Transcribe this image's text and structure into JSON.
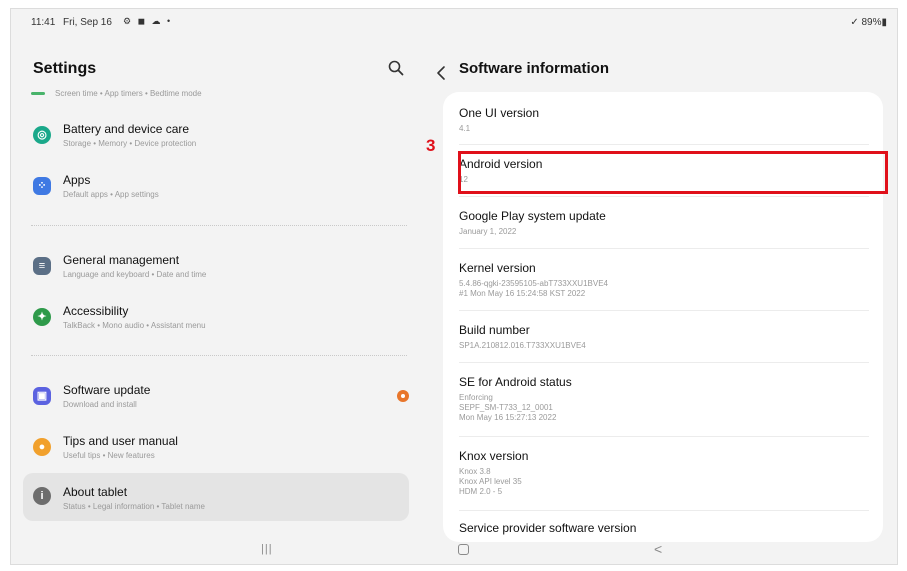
{
  "status_bar": {
    "time": "11:41",
    "date": "Fri, Sep 16",
    "icons": "⚙ ◼ ☁ •",
    "battery": "✓ 89%▮"
  },
  "left_pane": {
    "title": "Settings",
    "cut_item_sub": "Screen time  •  App timers  •  Bedtime mode",
    "items": [
      {
        "title": "Battery and device care",
        "sub": "Storage  •  Memory  •  Device protection",
        "icon": "battery-care-icon",
        "color": "#1aa88a"
      },
      {
        "title": "Apps",
        "sub": "Default apps  •  App settings",
        "icon": "apps-icon",
        "color": "#3f79e3"
      },
      {
        "title": "General management",
        "sub": "Language and keyboard  •  Date and time",
        "icon": "general-management-icon",
        "color": "#5b6f86"
      },
      {
        "title": "Accessibility",
        "sub": "TalkBack  •  Mono audio  •  Assistant menu",
        "icon": "accessibility-icon",
        "color": "#2e9a4a"
      },
      {
        "title": "Software update",
        "sub": "Download and install",
        "icon": "software-update-icon",
        "color": "#5b62e0"
      },
      {
        "title": "Tips and user manual",
        "sub": "Useful tips  •  New features",
        "icon": "tips-icon",
        "color": "#f1a02c"
      },
      {
        "title": "About tablet",
        "sub": "Status  •  Legal information  •  Tablet name",
        "icon": "about-tablet-icon",
        "color": "#6d6d6d"
      }
    ]
  },
  "right_pane": {
    "title": "Software information",
    "rows": [
      {
        "title": "One UI version",
        "values": [
          "4.1"
        ]
      },
      {
        "title": "Android version",
        "values": [
          "12"
        ]
      },
      {
        "title": "Google Play system update",
        "values": [
          "January 1, 2022"
        ]
      },
      {
        "title": "Kernel version",
        "values": [
          "5.4.86-qgki-23595105-abT733XXU1BVE4",
          "#1 Mon May 16 15:24:58 KST 2022"
        ]
      },
      {
        "title": "Build number",
        "values": [
          "SP1A.210812.016.T733XXU1BVE4"
        ]
      },
      {
        "title": "SE for Android status",
        "values": [
          "Enforcing",
          "SEPF_SM-T733_12_0001",
          "Mon May 16 15:27:13 2022"
        ]
      },
      {
        "title": "Knox version",
        "values": [
          "Knox 3.8",
          "Knox API level 35",
          "HDM 2.0 - 5"
        ]
      },
      {
        "title": "Service provider software version",
        "values": []
      }
    ]
  },
  "annotation": {
    "step": "3",
    "color": "#e0101a"
  },
  "nav_bar": {
    "recents": "|||",
    "back": "<"
  }
}
